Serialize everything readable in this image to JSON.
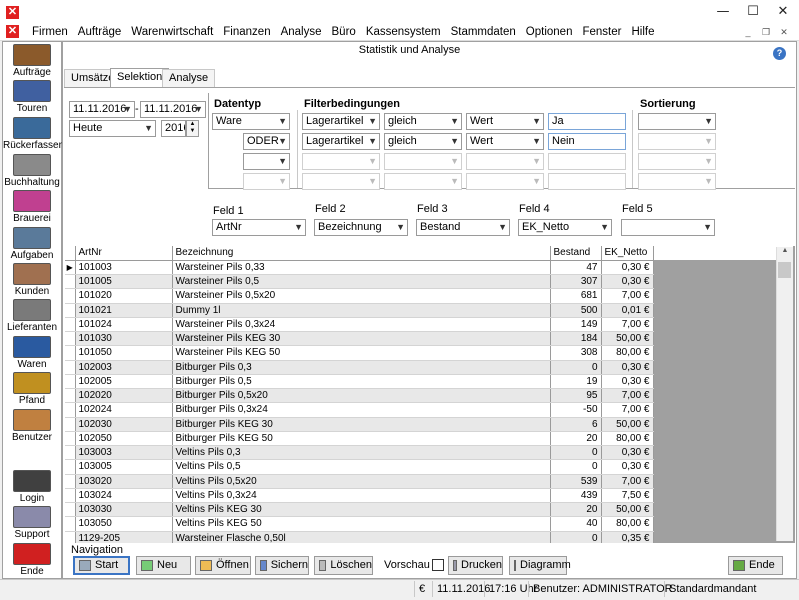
{
  "window": {
    "minimize": "—",
    "maximize": "☐",
    "close": "✕"
  },
  "menu": [
    "Firmen",
    "Aufträge",
    "Warenwirtschaft",
    "Finanzen",
    "Analyse",
    "Büro",
    "Kassensystem",
    "Stammdaten",
    "Optionen",
    "Fenster",
    "Hilfe"
  ],
  "mdi": {
    "minimize": "_",
    "restore": "❐",
    "close": "✕"
  },
  "sidebar": [
    {
      "label": "Aufträge",
      "color": "#8b5a2b"
    },
    {
      "label": "Touren",
      "color": "#4060a0"
    },
    {
      "label": "Rückerfassen",
      "color": "#3a6a9a"
    },
    {
      "label": "Buchhaltung",
      "color": "#8a8a8a"
    },
    {
      "label": "Brauerei",
      "color": "#c04090"
    },
    {
      "label": "Aufgaben",
      "color": "#5a7a9a"
    },
    {
      "label": "Kunden",
      "color": "#a07050"
    },
    {
      "label": "Lieferanten",
      "color": "#7a7a7a"
    },
    {
      "label": "Waren",
      "color": "#2a5aa0"
    },
    {
      "label": "Pfand",
      "color": "#c09020"
    },
    {
      "label": "Benutzer",
      "color": "#c08040"
    },
    {
      "label": "Login",
      "color": "#404040"
    },
    {
      "label": "Support",
      "color": "#8a8aaa"
    },
    {
      "label": "Ende",
      "color": "#d02020"
    }
  ],
  "title": "Statistik und Analyse",
  "help": "?",
  "tabs": [
    "Umsätze",
    "Selektion",
    "Analyse"
  ],
  "date": {
    "from": "11.11.2016",
    "to": "11.11.2016",
    "dash": "-",
    "period": "Heute",
    "year": "2016"
  },
  "filter": {
    "headers": {
      "datentyp": "Datentyp",
      "filter": "Filterbedingungen",
      "sort": "Sortierung"
    },
    "row1": {
      "type": "Ware",
      "field": "Lagerartikel",
      "op": "gleich",
      "mode": "Wert",
      "value": "Ja"
    },
    "row2": {
      "conj": "ODER",
      "field": "Lagerartikel",
      "op": "gleich",
      "mode": "Wert",
      "value": "Nein"
    }
  },
  "fields": [
    {
      "label": "Feld 1",
      "value": "ArtNr"
    },
    {
      "label": "Feld 2",
      "value": "Bezeichnung"
    },
    {
      "label": "Feld 3",
      "value": "Bestand"
    },
    {
      "label": "Feld 4",
      "value": "EK_Netto"
    },
    {
      "label": "Feld 5",
      "value": ""
    }
  ],
  "grid": {
    "columns": [
      "ArtNr",
      "Bezeichnung",
      "Bestand",
      "EK_Netto"
    ],
    "current_marker": "▶",
    "rows": [
      [
        "101003",
        "Warsteiner Pils 0,33",
        "47",
        "0,30 €"
      ],
      [
        "101005",
        "Warsteiner Pils 0,5",
        "307",
        "0,30 €"
      ],
      [
        "101020",
        "Warsteiner Pils 0,5x20",
        "681",
        "7,00 €"
      ],
      [
        "101021",
        "Dummy  1l",
        "500",
        "0,01 €"
      ],
      [
        "101024",
        "Warsteiner Pils 0,3x24",
        "149",
        "7,00 €"
      ],
      [
        "101030",
        "Warsteiner Pils KEG 30",
        "184",
        "50,00 €"
      ],
      [
        "101050",
        "Warsteiner Pils KEG 50",
        "308",
        "80,00 €"
      ],
      [
        "102003",
        "Bitburger Pils 0,3",
        "0",
        "0,30 €"
      ],
      [
        "102005",
        "Bitburger Pils 0,5",
        "19",
        "0,30 €"
      ],
      [
        "102020",
        "Bitburger Pils 0,5x20",
        "95",
        "7,00 €"
      ],
      [
        "102024",
        "Bitburger Pils 0,3x24",
        "-50",
        "7,00 €"
      ],
      [
        "102030",
        "Bitburger Pils KEG 30",
        "6",
        "50,00 €"
      ],
      [
        "102050",
        "Bitburger Pils KEG 50",
        "20",
        "80,00 €"
      ],
      [
        "103003",
        "Veltins Pils 0,3",
        "0",
        "0,30 €"
      ],
      [
        "103005",
        "Veltins Pils 0,5",
        "0",
        "0,30 €"
      ],
      [
        "103020",
        "Veltins Pils 0,5x20",
        "539",
        "7,00 €"
      ],
      [
        "103024",
        "Veltins Pils 0,3x24",
        "439",
        "7,50 €"
      ],
      [
        "103030",
        "Veltins Pils KEG 30",
        "20",
        "50,00 €"
      ],
      [
        "103050",
        "Veltins Pils KEG 50",
        "40",
        "80,00 €"
      ],
      [
        "1129-205",
        "Warsteiner  Flasche 0,50l",
        "0",
        "0,35 €"
      ]
    ]
  },
  "nav": {
    "label": "Navigation",
    "start": "Start",
    "neu": "Neu",
    "oeffnen": "Öffnen",
    "sichern": "Sichern",
    "loeschen": "Löschen",
    "vorschau": "Vorschau",
    "drucken": "Drucken",
    "diagramm": "Diagramm",
    "ende": "Ende"
  },
  "status": {
    "currency": "€",
    "date": "11.11.2016",
    "time": "17:16 Uhr",
    "user": "Benutzer: ADMINISTRATOR",
    "mandant": "Standardmandant"
  }
}
